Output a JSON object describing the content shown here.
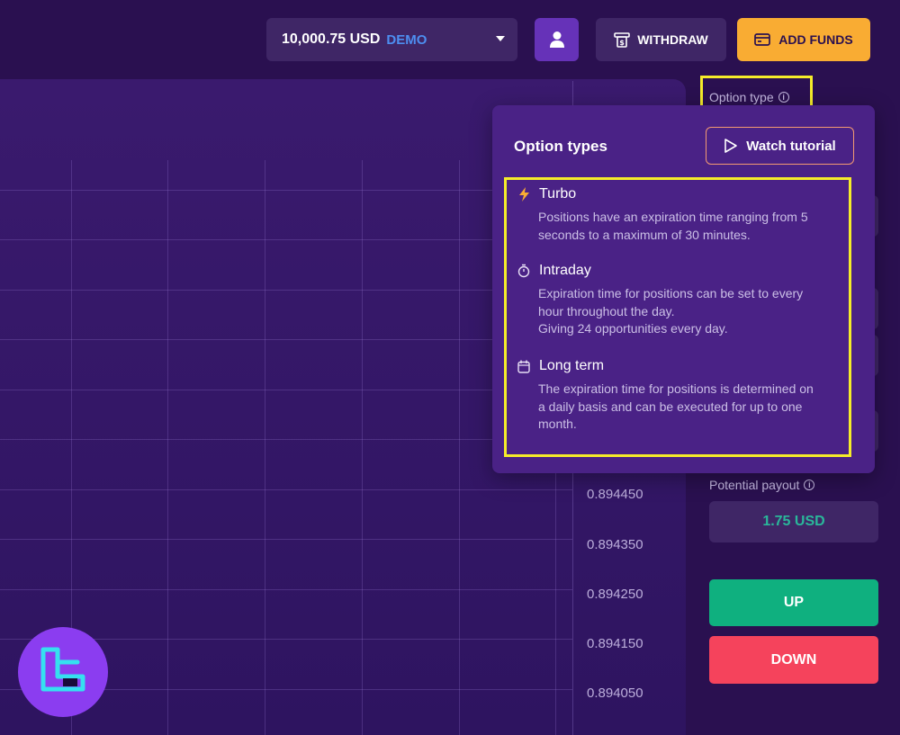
{
  "header": {
    "balance_amount": "10,000.75 USD",
    "balance_mode": "DEMO",
    "withdraw_label": "WITHDRAW",
    "add_funds_label": "ADD FUNDS"
  },
  "chart": {
    "price_labels": [
      "0.894450",
      "0.894350",
      "0.894250",
      "0.894150",
      "0.894050"
    ]
  },
  "sidebar": {
    "option_type_label": "Option type",
    "potential_payout_label": "Potential payout",
    "potential_payout_value": "1.75 USD",
    "up_label": "UP",
    "down_label": "DOWN"
  },
  "popup": {
    "title": "Option types",
    "watch_tutorial_label": "Watch tutorial",
    "options": [
      {
        "icon": "lightning-icon",
        "name": "Turbo",
        "lines": [
          "Positions have an expiration time ranging from 5",
          "seconds to a maximum of 30 minutes."
        ]
      },
      {
        "icon": "stopwatch-icon",
        "name": "Intraday",
        "lines": [
          "Expiration time for positions can be set to every",
          "hour throughout the day.",
          "Giving 24 opportunities every day."
        ]
      },
      {
        "icon": "calendar-icon",
        "name": "Long term",
        "lines": [
          "The expiration time for positions is determined on",
          "a daily basis and can be executed for up to one",
          "month."
        ]
      }
    ]
  },
  "colors": {
    "background": "#2a1050",
    "popup": "#4a2286",
    "accent_orange": "#f9ac33",
    "up_green": "#0fb07f",
    "down_red": "#f5435c",
    "highlight_yellow": "#f5ec2a"
  }
}
